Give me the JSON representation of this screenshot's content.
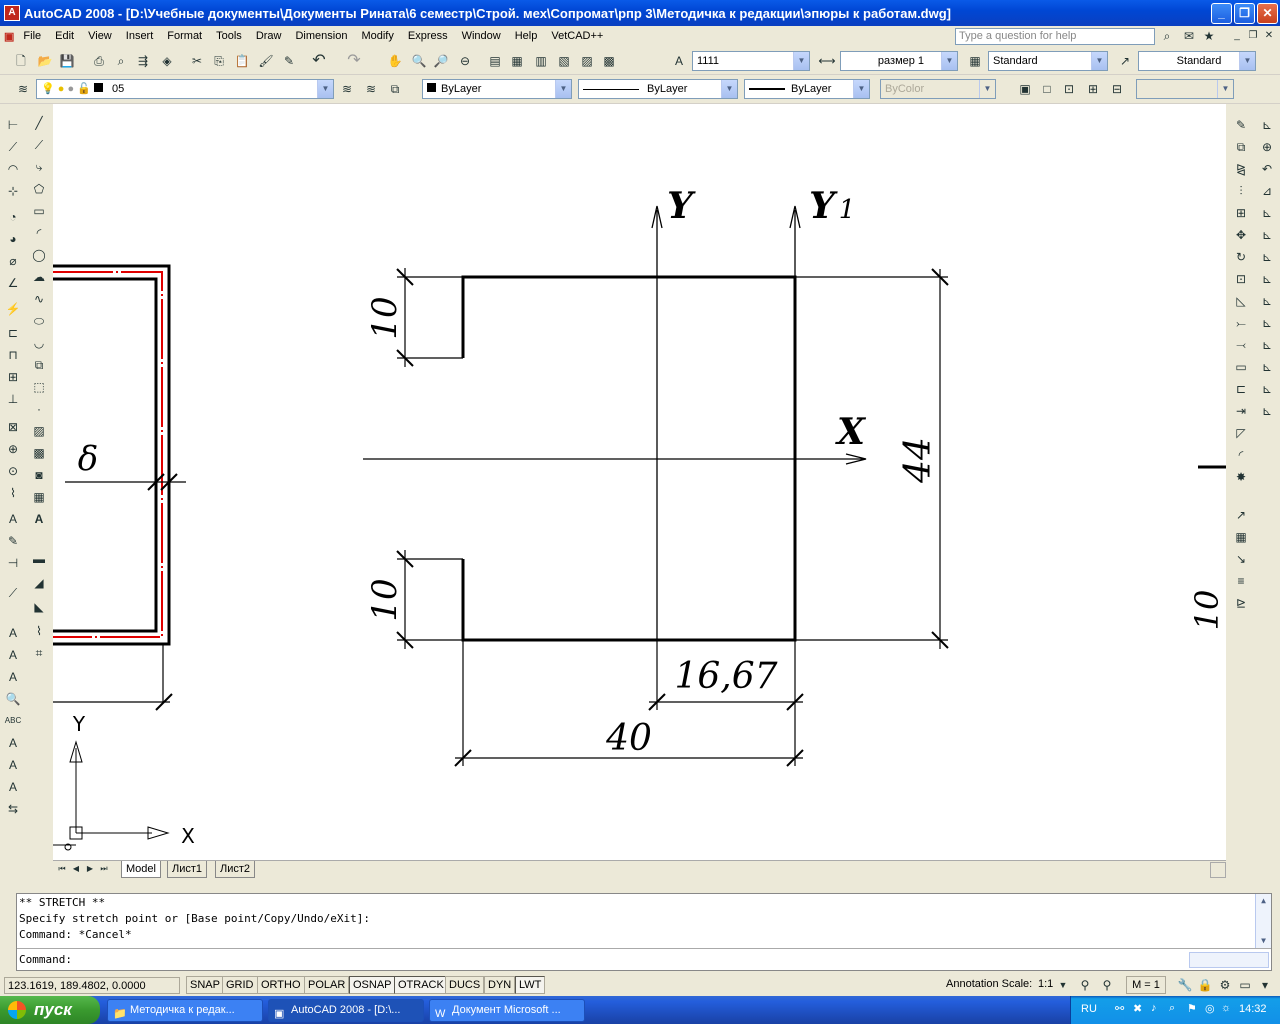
{
  "titlebar": {
    "title": "AutoCAD 2008 - [D:\\Учебные документы\\Документы Рината\\6 семестр\\Строй. мех\\Сопромат\\рпр 3\\Методичка к редакции\\эпюры к работам.dwg]"
  },
  "menubar": {
    "items": [
      "File",
      "Edit",
      "View",
      "Insert",
      "Format",
      "Tools",
      "Draw",
      "Dimension",
      "Modify",
      "Express",
      "Window",
      "Help",
      "VetCAD++"
    ],
    "help_placeholder": "Type a question for help"
  },
  "toolbar_standard": {
    "text_style": "1111",
    "dim_style": "размер 1",
    "table_style": "Standard",
    "multileader_style": "Standard"
  },
  "toolbar_layers": {
    "layer": "05",
    "color": "ByLayer",
    "linetype": "ByLayer",
    "lineweight": "ByLayer",
    "plotstyle": "ByColor"
  },
  "drawing": {
    "label_y": "Y",
    "label_y1": "Y",
    "label_y1_sub": "1",
    "label_x": "X",
    "dim_top": "10",
    "dim_bottom": "10",
    "dim_height": "44",
    "dim_1667": "16,67",
    "dim_40": "40",
    "delta": "δ",
    "dim_right_partial": "10",
    "ucs_y": "Y",
    "ucs_x": "X"
  },
  "tabs": {
    "model": "Model",
    "layout1": "Лист1",
    "layout2": "Лист2"
  },
  "command": {
    "line1": "** STRETCH **",
    "line2": "Specify stretch point or [Base point/Copy/Undo/eXit]:",
    "line3": "Command: *Cancel*",
    "prompt": "Command:"
  },
  "statusbar": {
    "coords": "123.1619, 189.4802, 0.0000",
    "buttons": [
      "SNAP",
      "GRID",
      "ORTHO",
      "POLAR",
      "OSNAP",
      "OTRACK",
      "DUCS",
      "DYN",
      "LWT"
    ],
    "annotation_scale_label": "Annotation Scale:",
    "annotation_scale": "1:1",
    "m_value": "M = 1"
  },
  "taskbar": {
    "start": "пуск",
    "tasks": [
      "Методичка к редак...",
      "AutoCAD 2008 - [D:\\...",
      "Документ Microsoft ..."
    ],
    "lang": "RU",
    "clock": "14:32"
  }
}
